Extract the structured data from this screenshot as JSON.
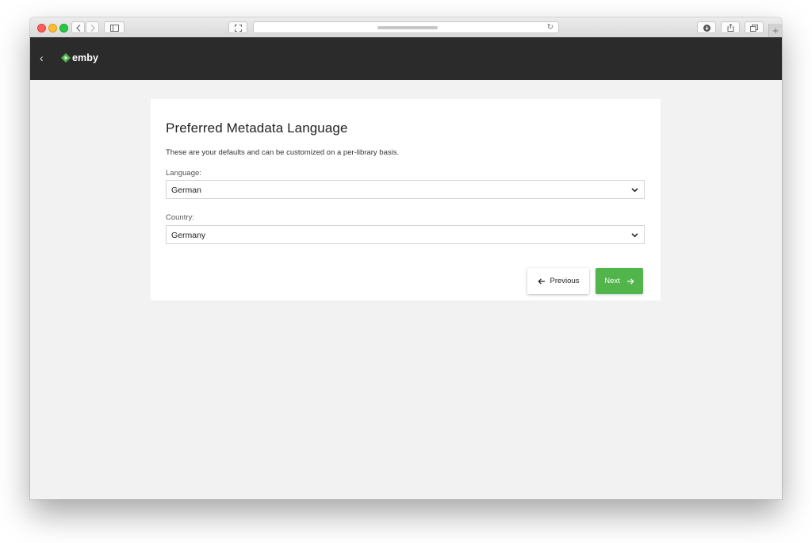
{
  "browser": {
    "reload_glyph": "↻",
    "new_tab_glyph": "+",
    "icons": [
      "back-arrow-icon",
      "forward-arrow-icon",
      "sidebar-icon",
      "fullscreen-icon",
      "reload-icon",
      "download-icon",
      "share-icon",
      "tabs-icon",
      "new-tab-icon"
    ]
  },
  "header": {
    "back_glyph": "‹",
    "logo_text": "emby"
  },
  "wizard": {
    "title": "Preferred Metadata Language",
    "description": "These are your defaults and can be customized on a per-library basis.",
    "language": {
      "label": "Language:",
      "value": "German"
    },
    "country": {
      "label": "Country:",
      "value": "Germany"
    },
    "previous_label": "Previous",
    "next_label": "Next"
  },
  "colors": {
    "header_bg": "#2b2b2b",
    "page_bg": "#f2f2f2",
    "accent_green": "#52b54b"
  }
}
